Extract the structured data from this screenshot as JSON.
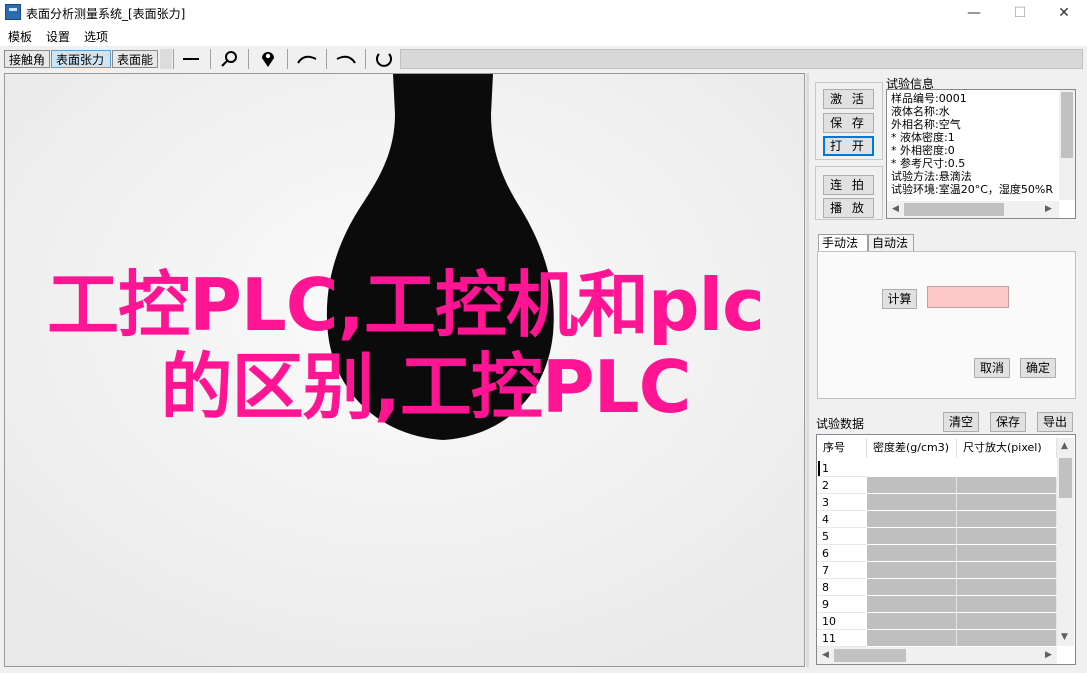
{
  "window": {
    "title": "表面分析测量系统_[表面张力]",
    "minimize_glyph": "—",
    "maximize_glyph": "☐",
    "close_glyph": "✕"
  },
  "menu": [
    "模板",
    "设置",
    "选项"
  ],
  "toolbar": {
    "tabs": [
      "接触角",
      "表面张力",
      "表面能"
    ],
    "active_tab": "表面张力",
    "tools": [
      {
        "icon": "line-tool-icon",
        "glyph": "—"
      },
      {
        "icon": "zoom-icon",
        "glyph": "⚲"
      },
      {
        "icon": "location-pin-icon",
        "glyph": "⚲"
      },
      {
        "icon": "arc-left-icon",
        "glyph": "⌒"
      },
      {
        "icon": "arc-right-icon",
        "glyph": "⌒"
      },
      {
        "icon": "rotate-icon",
        "glyph": "↻"
      }
    ]
  },
  "overlay": {
    "line1": "工控PLC,工控机和plc",
    "line2": "的区别,工控PLC",
    "color": "#ff1493"
  },
  "controls": {
    "activate": "激 活",
    "save": "保 存",
    "open": "打 开",
    "burst": "连 拍",
    "play": "播 放"
  },
  "test_info": {
    "label": "试验信息",
    "lines": [
      "样品编号:0001",
      "液体名称:水",
      "外相名称:空气",
      "* 液体密度:1",
      "* 外相密度:0",
      "* 参考尺寸:0.5",
      "试验方法:悬滴法",
      "试验环境:室温20°C，湿度50%R"
    ]
  },
  "method_tabs": [
    "手动法",
    "自动法"
  ],
  "active_method": "手动法",
  "manual": {
    "calc": "计算",
    "cancel": "取消",
    "confirm": "确定",
    "result_value": ""
  },
  "test_data": {
    "label": "试验数据",
    "clear": "清空",
    "save": "保存",
    "export": "导出",
    "columns": [
      "序号",
      "密度差(g/cm3)",
      "尺寸放大(pixel)"
    ],
    "rows": [
      "1",
      "2",
      "3",
      "4",
      "5",
      "6",
      "7",
      "8",
      "9",
      "10",
      "11"
    ]
  }
}
